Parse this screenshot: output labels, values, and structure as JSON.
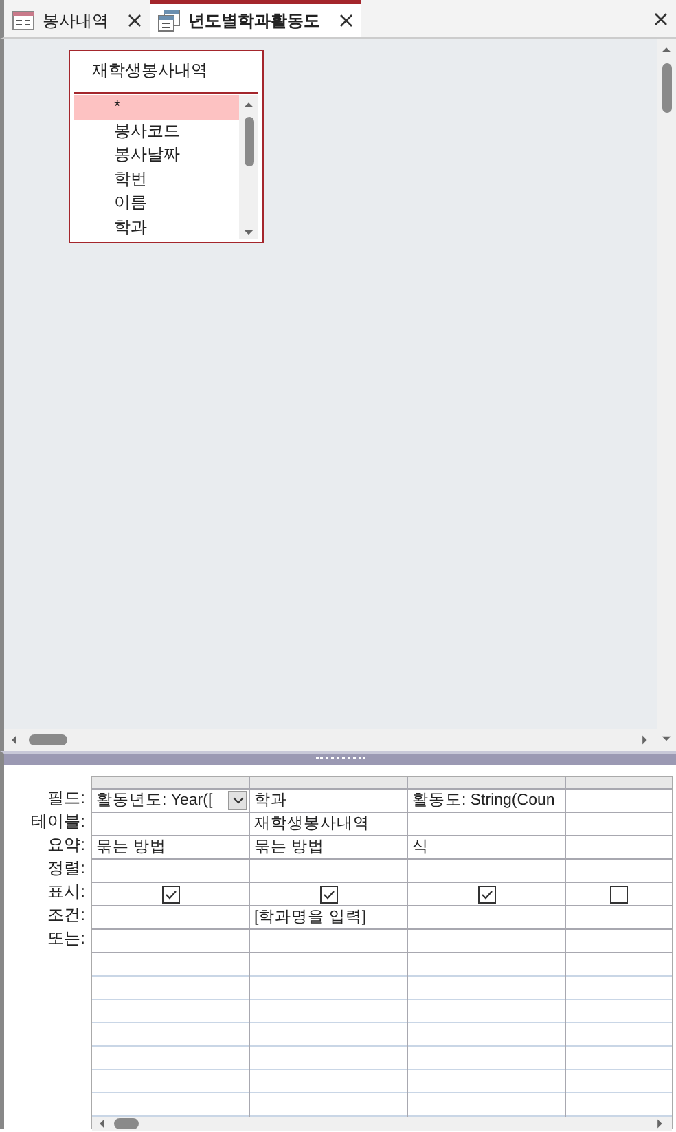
{
  "tabs": [
    {
      "label": "봉사내역",
      "kind": "table",
      "selected": false
    },
    {
      "label": "년도별학과활동도",
      "kind": "query",
      "selected": true
    }
  ],
  "table_box": {
    "title": "재학생봉사내역",
    "fields": [
      {
        "label": "*",
        "selected": true
      },
      {
        "label": "봉사코드",
        "selected": false
      },
      {
        "label": "봉사날짜",
        "selected": false
      },
      {
        "label": "학번",
        "selected": false
      },
      {
        "label": "이름",
        "selected": false
      },
      {
        "label": "학과",
        "selected": false
      }
    ]
  },
  "grid": {
    "row_labels": [
      "필드:",
      "테이블:",
      "요약:",
      "정렬:",
      "표시:",
      "조건:",
      "또는:"
    ],
    "columns": [
      {
        "field": "활동년도: Year([",
        "focused": true,
        "total": "묶는 방법",
        "show": true
      },
      {
        "field": "학과",
        "focused": false,
        "table": "재학생봉사내역",
        "total": "묶는 방법",
        "show": true,
        "criteria": "[학과명을 입력]"
      },
      {
        "field": "활동도: String(Coun",
        "focused": false,
        "total": "식",
        "show": true
      },
      {
        "focused": false,
        "show": false
      }
    ]
  }
}
